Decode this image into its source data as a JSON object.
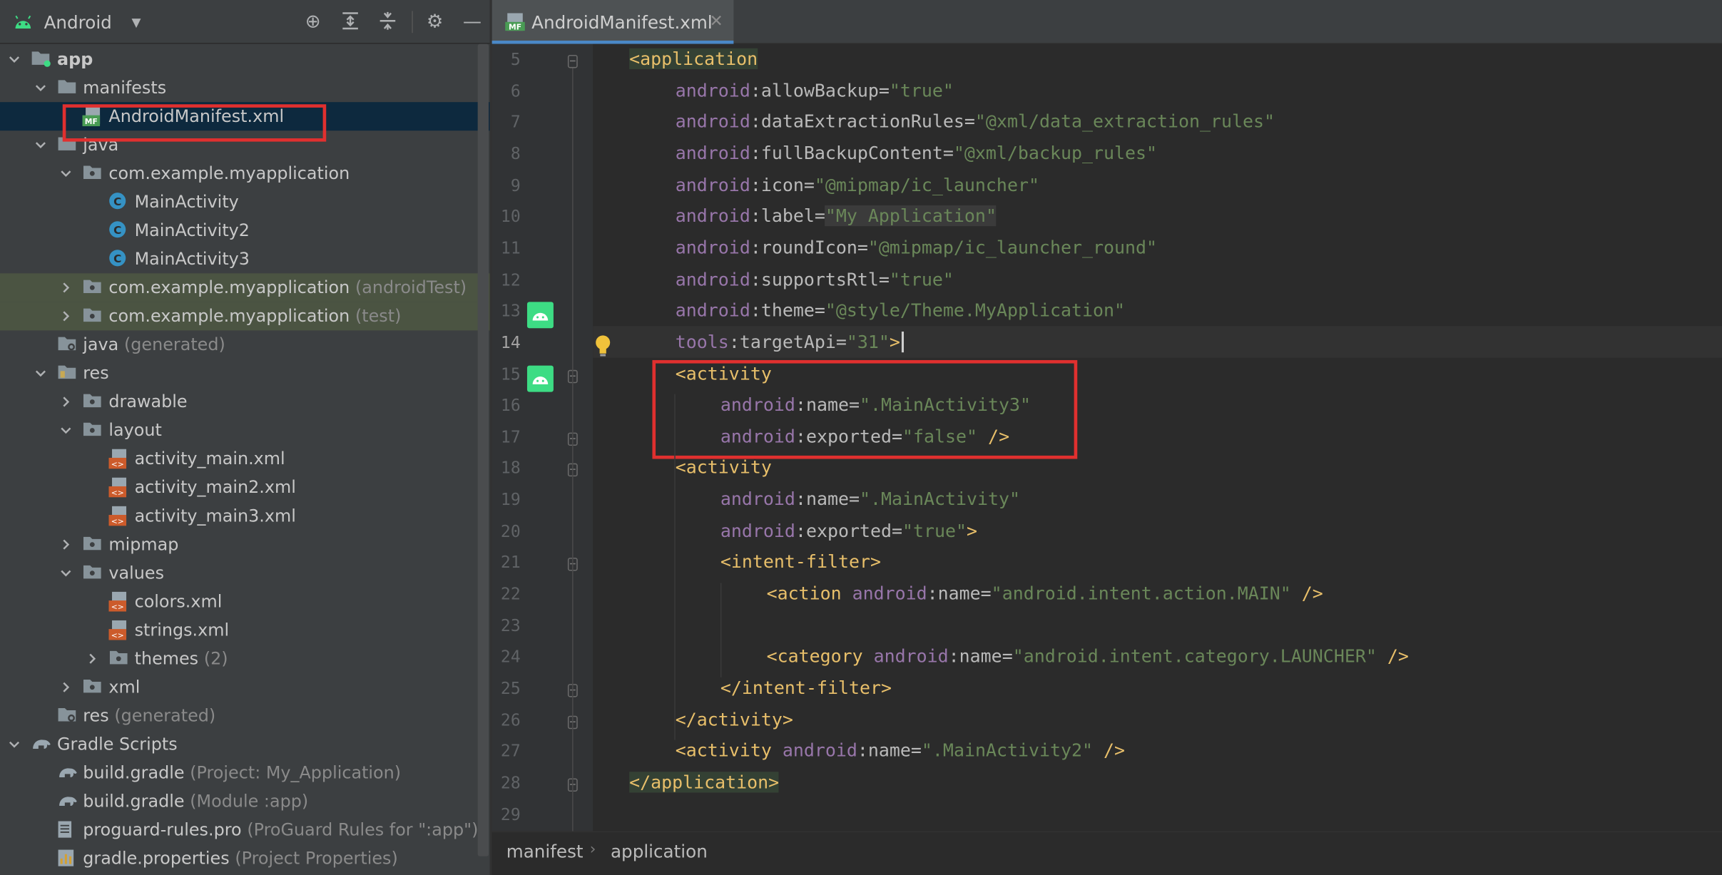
{
  "project_panel": {
    "view_selector": "Android",
    "tree": [
      {
        "label": "app",
        "hint": ""
      },
      {
        "label": "manifests",
        "hint": ""
      },
      {
        "label": "AndroidManifest.xml",
        "hint": ""
      },
      {
        "label": "java",
        "hint": ""
      },
      {
        "label": "com.example.myapplication",
        "hint": ""
      },
      {
        "label": "MainActivity",
        "hint": ""
      },
      {
        "label": "MainActivity2",
        "hint": ""
      },
      {
        "label": "MainActivity3",
        "hint": ""
      },
      {
        "label": "com.example.myapplication",
        "hint": "(androidTest)"
      },
      {
        "label": "com.example.myapplication",
        "hint": "(test)"
      },
      {
        "label": "java",
        "hint": "(generated)"
      },
      {
        "label": "res",
        "hint": ""
      },
      {
        "label": "drawable",
        "hint": ""
      },
      {
        "label": "layout",
        "hint": ""
      },
      {
        "label": "activity_main.xml",
        "hint": ""
      },
      {
        "label": "activity_main2.xml",
        "hint": ""
      },
      {
        "label": "activity_main3.xml",
        "hint": ""
      },
      {
        "label": "mipmap",
        "hint": ""
      },
      {
        "label": "values",
        "hint": ""
      },
      {
        "label": "colors.xml",
        "hint": ""
      },
      {
        "label": "strings.xml",
        "hint": ""
      },
      {
        "label": "themes",
        "hint": "(2)"
      },
      {
        "label": "xml",
        "hint": ""
      },
      {
        "label": "res",
        "hint": "(generated)"
      },
      {
        "label": "Gradle Scripts",
        "hint": ""
      },
      {
        "label": "build.gradle",
        "hint": "(Project: My_Application)"
      },
      {
        "label": "build.gradle",
        "hint": "(Module :app)"
      },
      {
        "label": "proguard-rules.pro",
        "hint": "(ProGuard Rules for \":app\")"
      },
      {
        "label": "gradle.properties",
        "hint": "(Project Properties)"
      }
    ]
  },
  "editor": {
    "tab_title": "AndroidManifest.xml",
    "tab_icon_text": "MF",
    "line_numbers": [
      "5",
      "6",
      "7",
      "8",
      "9",
      "10",
      "11",
      "12",
      "13",
      "14",
      "15",
      "16",
      "17",
      "18",
      "19",
      "20",
      "21",
      "22",
      "23",
      "24",
      "25",
      "26",
      "27",
      "28",
      "29"
    ],
    "code": [
      [
        "<application"
      ],
      [
        "android",
        ":allowBackup=",
        "\"true\""
      ],
      [
        "android",
        ":dataExtractionRules=",
        "\"@xml/data_extraction_rules\""
      ],
      [
        "android",
        ":fullBackupContent=",
        "\"@xml/backup_rules\""
      ],
      [
        "android",
        ":icon=",
        "\"@mipmap/ic_launcher\""
      ],
      [
        "android",
        ":label=",
        "\"My Application\""
      ],
      [
        "android",
        ":roundIcon=",
        "\"@mipmap/ic_launcher_round\""
      ],
      [
        "android",
        ":supportsRtl=",
        "\"true\""
      ],
      [
        "android",
        ":theme=",
        "\"@style/Theme.MyApplication\""
      ],
      [
        "tools",
        ":targetApi=",
        "\"31\"",
        ">"
      ],
      [
        "<activity"
      ],
      [
        "android",
        ":name=",
        "\".MainActivity3\""
      ],
      [
        "android",
        ":exported=",
        "\"false\"",
        " />"
      ],
      [
        "<activity"
      ],
      [
        "android",
        ":name=",
        "\".MainActivity\""
      ],
      [
        "android",
        ":exported=",
        "\"true\"",
        ">"
      ],
      [
        "<intent-filter>"
      ],
      [
        "<action ",
        "android",
        ":name=",
        "\"android.intent.action.MAIN\"",
        " />"
      ],
      [
        ""
      ],
      [
        "<category ",
        "android",
        ":name=",
        "\"android.intent.category.LAUNCHER\"",
        " />"
      ],
      [
        "</intent-filter>"
      ],
      [
        "</activity>"
      ],
      [
        "<activity ",
        "android",
        ":name=",
        "\".MainActivity2\"",
        " />"
      ],
      [
        "</application>"
      ],
      [
        ""
      ]
    ]
  },
  "breadcrumb": [
    "manifest",
    "application"
  ],
  "colors": {
    "highlight_box": "#e0302f",
    "selection": "#0d293e",
    "test_bg": "#4b5442"
  }
}
